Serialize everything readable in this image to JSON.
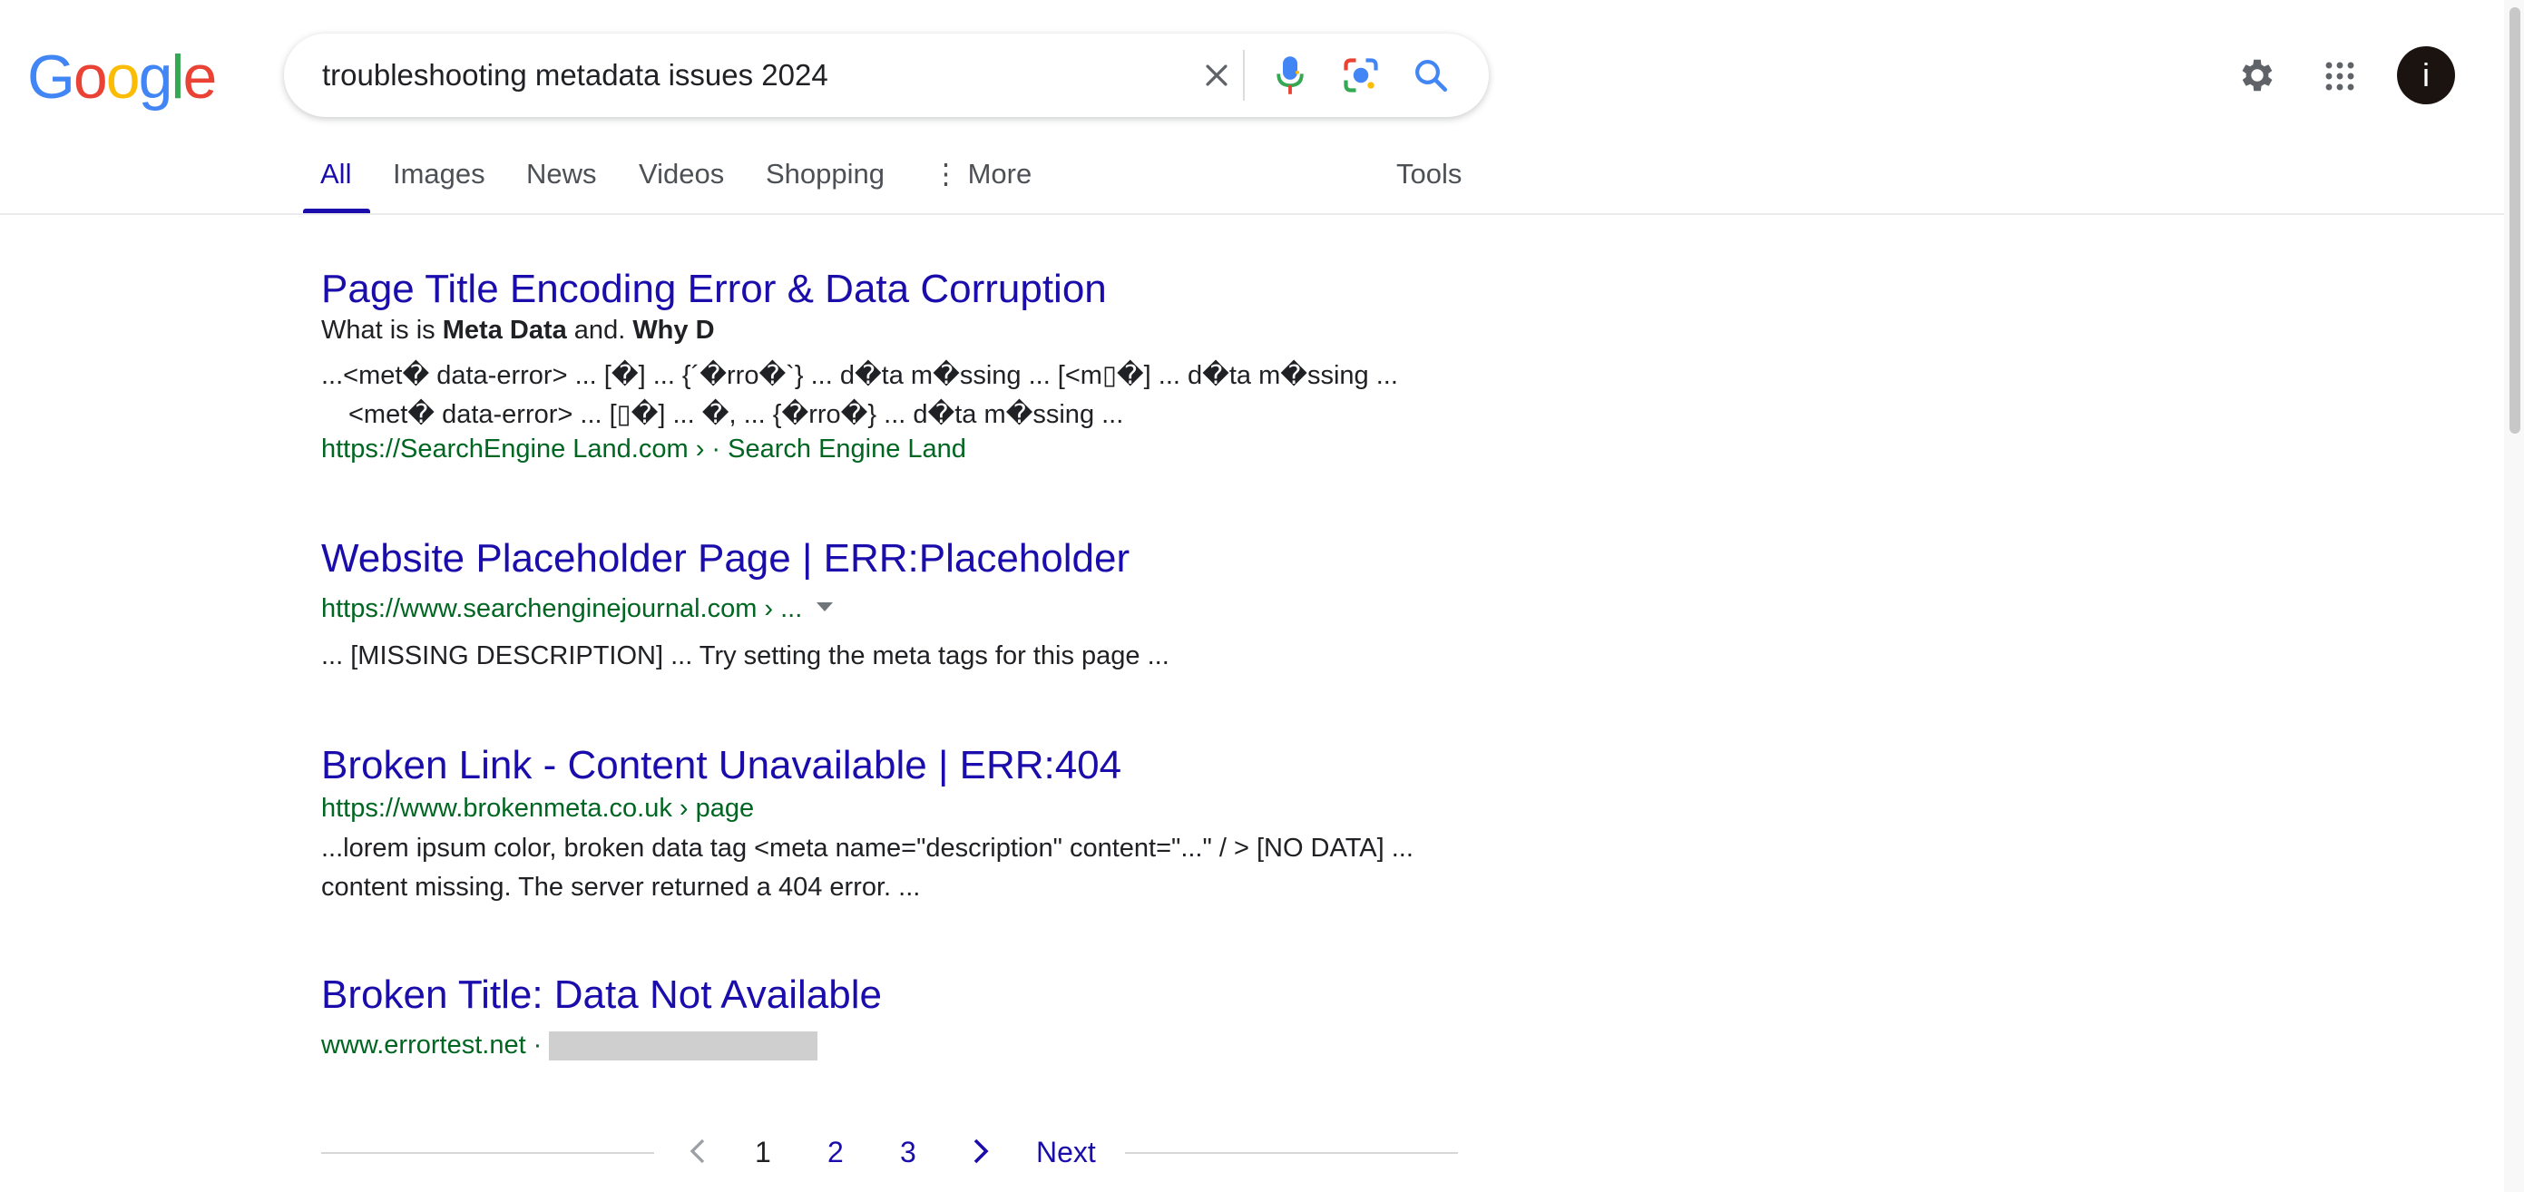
{
  "header": {
    "logo_letters": [
      {
        "ch": "G",
        "color": "#4285F4"
      },
      {
        "ch": "o",
        "color": "#EA4335"
      },
      {
        "ch": "o",
        "color": "#FBBC05"
      },
      {
        "ch": "g",
        "color": "#4285F4"
      },
      {
        "ch": "l",
        "color": "#34A853"
      },
      {
        "ch": "e",
        "color": "#EA4335"
      }
    ],
    "search_query": "troubleshooting metadata issues 2024",
    "avatar_initial": "i"
  },
  "tabs": {
    "all": "All",
    "images": "Images",
    "news": "News",
    "videos": "Videos",
    "shopping": "Shopping",
    "more": "⋮ More",
    "tools": "Tools"
  },
  "results": [
    {
      "title": "Page Title Encoding Error & Data Corruption",
      "subtitle_prefix": "What is is ",
      "subtitle_bold1": "Meta Data",
      "subtitle_mid": " and. ",
      "subtitle_bold2": "Why D",
      "snippet_line1": "...<met� data-error> ... [�] ... {´�rro�`} ... d�ta m�ssing ... [<m▯�] ... d�ta m�ssing ...",
      "snippet_line2": "<met� data-error> ... [▯�] ... �, ... {�rro�} ... d�ta m�ssing ...",
      "url": "https://SearchEngine Land.com › · Search Engine Land"
    },
    {
      "title": "Website Placeholder Page | ERR:Placeholder",
      "url": "https://www.searchenginejournal.com › ...",
      "snippet": "... [MISSING DESCRIPTION] ... Try setting the meta tags for this page ..."
    },
    {
      "title": "Broken Link - Content Unavailable | ERR:404",
      "url": "https://www.brokenmeta.co.uk › page",
      "snippet_line1": "...lorem ipsum color, broken data tag <meta name=\"description\" content=\"...\" / > [NO DATA] ...",
      "snippet_line2": "content missing. The server returned a 404 error. ..."
    },
    {
      "title": "Broken Title: Data Not Available",
      "url": "www.errortest.net ·"
    }
  ],
  "pagination": {
    "pages": [
      "1",
      "2",
      "3"
    ],
    "next": "Next"
  },
  "colors": {
    "link_title": "#1a0dab",
    "url_green": "#006621",
    "accent_blue": "#1a73e8"
  },
  "icons": [
    "clear-icon",
    "microphone-icon",
    "lens-icon",
    "search-icon",
    "settings-gear-icon",
    "apps-grid-icon",
    "chevron-left-icon",
    "chevron-right-icon"
  ]
}
